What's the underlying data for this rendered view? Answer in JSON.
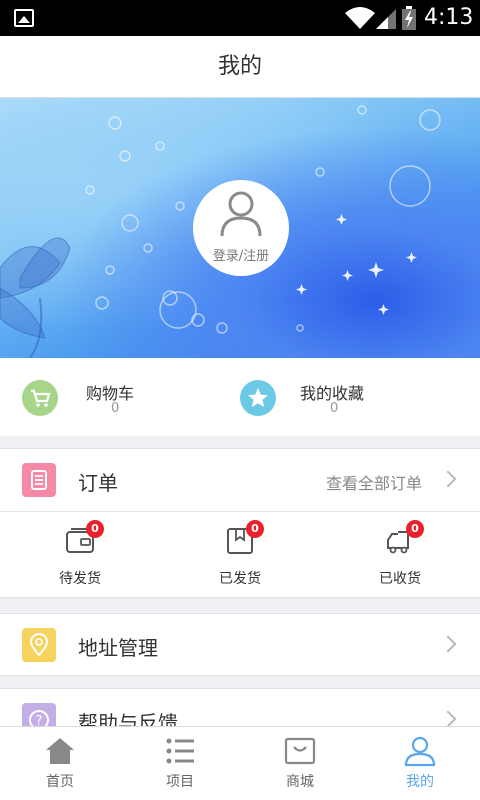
{
  "status_bar": {
    "time": "4:13"
  },
  "header": {
    "title": "我的"
  },
  "profile": {
    "login_label": "登录/注册"
  },
  "quick_links": [
    {
      "label": "购物车",
      "count": "0",
      "icon": "shopping-cart-icon",
      "color": "#a7d58a"
    },
    {
      "label": "我的收藏",
      "count": "0",
      "icon": "star-icon",
      "color": "#6cc9e6"
    }
  ],
  "orders": {
    "label": "订单",
    "view_all": "查看全部订单",
    "icon": "order-icon",
    "color": "#f48aa8",
    "statuses": [
      {
        "label": "待发货",
        "badge": "0",
        "icon": "wallet-icon"
      },
      {
        "label": "已发货",
        "badge": "0",
        "icon": "package-icon"
      },
      {
        "label": "已收货",
        "badge": "0",
        "icon": "delivery-truck-icon"
      }
    ]
  },
  "address": {
    "label": "地址管理",
    "icon": "location-pin-icon",
    "color": "#f5d35c"
  },
  "help": {
    "label": "帮助与反馈",
    "icon": "help-icon",
    "color": "#c3aee6"
  },
  "nav": [
    {
      "label": "首页",
      "icon": "home-icon"
    },
    {
      "label": "项目",
      "icon": "list-icon"
    },
    {
      "label": "商城",
      "icon": "shop-icon"
    },
    {
      "label": "我的",
      "icon": "user-icon",
      "active": true
    }
  ],
  "colors": {
    "accent": "#5aa6ee",
    "badge": "#e8222a"
  }
}
